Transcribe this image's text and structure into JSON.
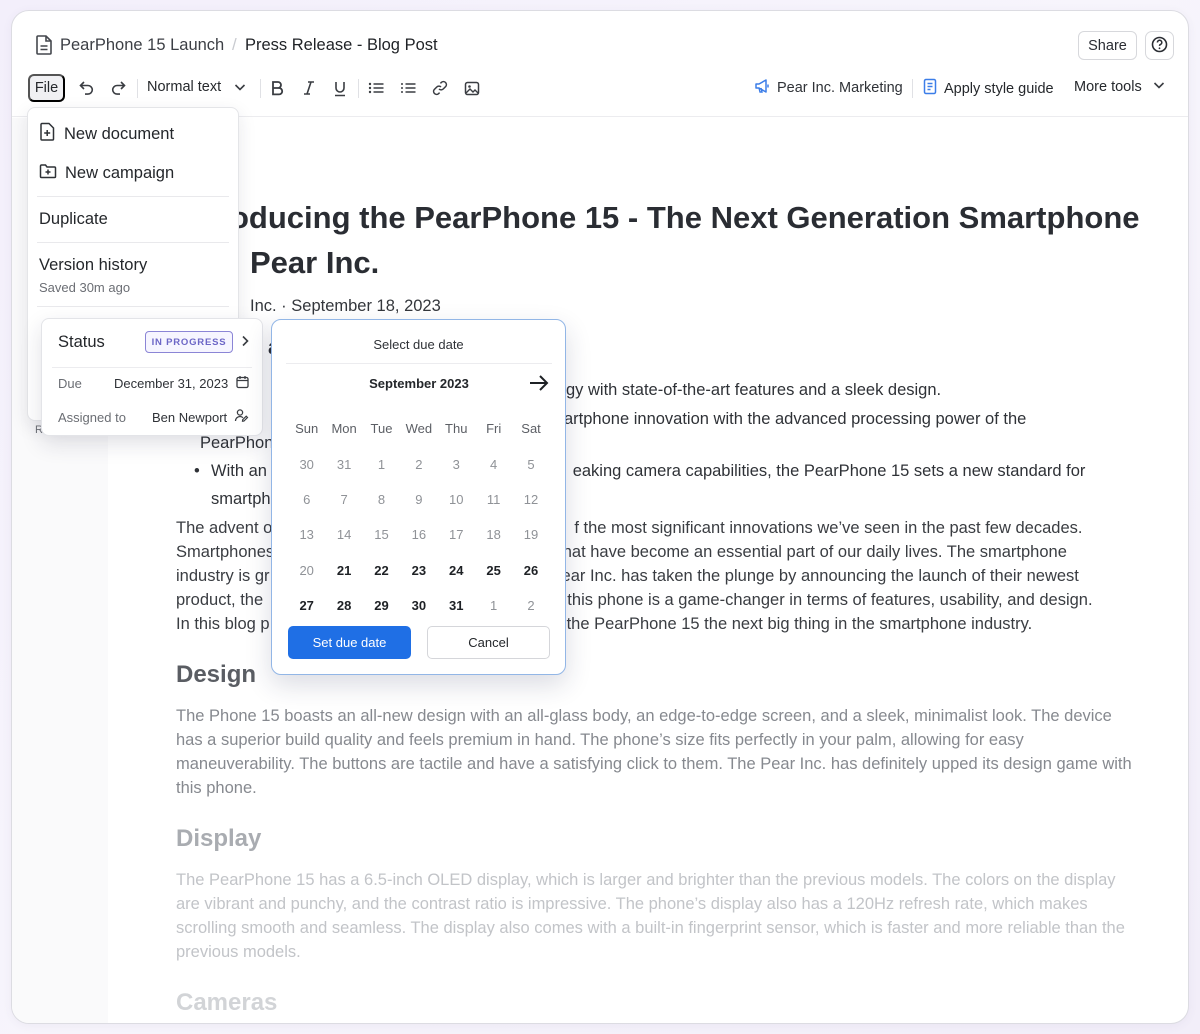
{
  "header": {
    "breadcrumb": [
      "PearPhone 15 Launch",
      "Press Release - Blog Post"
    ],
    "share_label": "Share",
    "icons": {
      "doc": "document-icon",
      "help": "help-circle-icon"
    }
  },
  "toolbar": {
    "file_label": "File",
    "text_style": "Normal text",
    "brand_label": "Pear Inc. Marketing",
    "style_guide_label": "Apply style guide",
    "more_tools_label": "More tools",
    "icons": [
      "undo-icon",
      "redo-icon",
      "bold-icon",
      "italic-icon",
      "underline-icon",
      "bulleted-list-icon",
      "numbered-list-icon",
      "link-icon",
      "image-icon"
    ]
  },
  "file_menu": {
    "new_document": "New document",
    "new_campaign": "New campaign",
    "duplicate": "Duplicate",
    "version_history": "Version history",
    "saved": "Saved 30m ago",
    "stub": "R"
  },
  "status_card": {
    "status_label": "Status",
    "badge": "IN PROGRESS",
    "due_label": "Due",
    "due_value": "December 31, 2023",
    "assigned_label": "Assigned to",
    "assigned_value": "Ben Newport"
  },
  "datepicker": {
    "title": "Select due date",
    "month": "September 2023",
    "weekdays": [
      "Sun",
      "Mon",
      "Tue",
      "Wed",
      "Thu",
      "Fri",
      "Sat"
    ],
    "weeks": [
      [
        "30",
        "31",
        "1",
        "2",
        "3",
        "4",
        "5"
      ],
      [
        "6",
        "7",
        "8",
        "9",
        "10",
        "11",
        "12"
      ],
      [
        "13",
        "14",
        "15",
        "16",
        "17",
        "18",
        "19"
      ],
      [
        "20",
        "21",
        "22",
        "23",
        "24",
        "25",
        "26"
      ],
      [
        "27",
        "28",
        "29",
        "30",
        "31",
        "1",
        "2"
      ]
    ],
    "bold_days": [
      "21",
      "22",
      "23",
      "24",
      "25",
      "26",
      "27",
      "28",
      "29",
      "30",
      "31"
    ],
    "set_label": "Set due date",
    "cancel_label": "Cancel"
  },
  "document": {
    "title": "oducing the PearPhone 15 - The Next Generation Smartphone\n  Pear Inc.",
    "byline": "Inc. · September 18, 2023",
    "partial_heading": "a",
    "bullets": [
      "gy with state-of-the-art features and a sleek design.",
      "artphone innovation with the advanced processing power of the\nPearPhon",
      "With an e                                        eaking camera capabilities, the PearPhone 15 sets a new standard for\nsmartpho"
    ],
    "intro": "The advent o                                           f the most significant innovations we’ve seen in the past few decades. Smartphones                                         ns that have become an essential part of our daily lives. The smartphone industry is gr                                         ear Inc. has taken the plunge by announcing the launch of their newest product, the                                          t this phone is a game-changer in terms of features, usability, and design. In this blog p                                          es the PearPhone 15 the next big thing in the smartphone industry.",
    "design_heading": "Design",
    "design_text": "The Phone 15 boasts an all-new design with an all-glass body, an edge-to-edge screen, and a sleek, minimalist look. The device has a superior build quality and feels premium in hand. The phone’s size fits perfectly in your palm, allowing for easy maneuverability. The buttons are tactile and have a satisfying click to them. The Pear Inc. has definitely upped its design game with this phone.",
    "display_heading": "Display",
    "display_text": "The PearPhone 15 has a 6.5-inch OLED display, which is larger and brighter than the previous models. The colors on the display are vibrant and punchy, and the contrast ratio is impressive. The phone’s display also has a 120Hz refresh rate, which makes scrolling smooth and seamless. The display also comes with a built-in fingerprint sensor, which is faster and more reliable than the previous models.",
    "cameras_heading": "Cameras"
  },
  "colors": {
    "accent": "#1f6fe5",
    "badge": "#6c66c6",
    "picker_border": "#92b6e6"
  }
}
